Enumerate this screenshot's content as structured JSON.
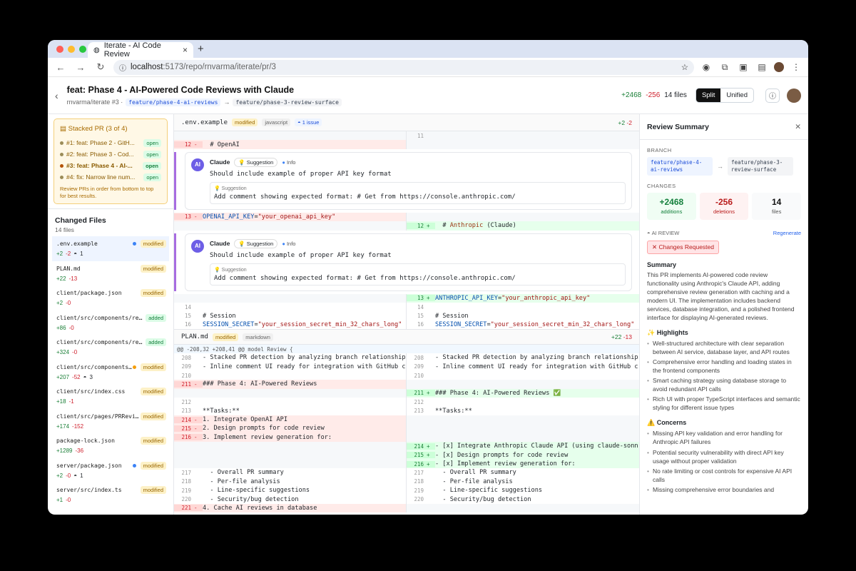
{
  "browser": {
    "tab_title": "Iterate - AI Code Review",
    "url_host": "localhost",
    "url_path": ":5173/repo/rnvarma/iterate/pr/3"
  },
  "header": {
    "title": "feat: Phase 4 - AI-Powered Code Reviews with Claude",
    "repo": "rnvarma/iterate #3 ·",
    "head_branch": "feature/phase-4-ai-reviews",
    "base_branch": "feature/phase-3-review-surface",
    "additions": "+2468",
    "deletions": "-256",
    "files": "14 files",
    "split": "Split",
    "unified": "Unified"
  },
  "stack": {
    "title": "Stacked PR (3 of 4)",
    "items": [
      {
        "label": "#1: feat: Phase 2 - GitH...",
        "status": "open"
      },
      {
        "label": "#2: feat: Phase 3 - Cod...",
        "status": "open"
      },
      {
        "label": "#3: feat: Phase 4 - AI-...",
        "status": "open"
      },
      {
        "label": "#4: fix: Narrow line num...",
        "status": "open"
      }
    ],
    "hint": "Review PRs in order from bottom to top for best results."
  },
  "changed": {
    "title": "Changed Files",
    "count": "14 files",
    "files": [
      {
        "name": ".env.example",
        "badge": "modified",
        "add": "+2",
        "del": "-2",
        "issues": "1",
        "dot": "#3b82f6"
      },
      {
        "name": "PLAN.md",
        "badge": "modified",
        "add": "+22",
        "del": "-13"
      },
      {
        "name": "client/package.json",
        "badge": "modified",
        "add": "+2",
        "del": "-0"
      },
      {
        "name": "client/src/components/re...",
        "badge": "added",
        "add": "+86",
        "del": "-0"
      },
      {
        "name": "client/src/components/re...",
        "badge": "added",
        "add": "+324",
        "del": "-0"
      },
      {
        "name": "client/src/components...",
        "badge": "modified",
        "add": "+207",
        "del": "-52",
        "issues": "3",
        "dot": "#f59e0b"
      },
      {
        "name": "client/src/index.css",
        "badge": "modified",
        "add": "+18",
        "del": "-1"
      },
      {
        "name": "client/src/pages/PRRevi...",
        "badge": "modified",
        "add": "+174",
        "del": "-152"
      },
      {
        "name": "package-lock.json",
        "badge": "modified",
        "add": "+1289",
        "del": "-36"
      },
      {
        "name": "server/package.json",
        "badge": "modified",
        "add": "+2",
        "del": "-0",
        "issues": "1",
        "dot": "#3b82f6"
      },
      {
        "name": "server/src/index.ts",
        "badge": "modified",
        "add": "+1",
        "del": "-0"
      }
    ]
  },
  "diff1": {
    "file": ".env.example",
    "status": "modified",
    "lang": "javascript",
    "issues": "1 issue",
    "add": "+2",
    "del": "-2",
    "comment": {
      "author": "Claude",
      "type": "Suggestion",
      "severity": "Info",
      "body": "Should include example of proper API key format",
      "sugg_label": "Suggestion",
      "sugg_body": "Add comment showing expected format: # Get from https://console.anthropic.com/"
    }
  },
  "diff2": {
    "file": "PLAN.md",
    "status": "modified",
    "lang": "markdown",
    "add": "+22",
    "del": "-13",
    "hunk": "@@ -208,32 +208,41 @@ model Review {"
  },
  "summary": {
    "title": "Review Summary",
    "branch_label": "BRANCH",
    "head": "feature/phase-4-ai-reviews",
    "base": "feature/phase-3-review-surface",
    "changes_label": "CHANGES",
    "add_v": "+2468",
    "add_k": "additions",
    "del_v": "-256",
    "del_k": "deletions",
    "files_v": "14",
    "files_k": "files",
    "ai_label": "AI REVIEW",
    "regen": "Regenerate",
    "verdict": "✕ Changes Requested",
    "sum_h": "Summary",
    "sum_t": "This PR implements AI-powered code review functionality using Anthropic's Claude API, adding comprehensive review generation with caching and a modern UI. The implementation includes backend services, database integration, and a polished frontend interface for displaying AI-generated reviews.",
    "hl_h": "✨ Highlights",
    "highlights": [
      "Well-structured architecture with clear separation between AI service, database layer, and API routes",
      "Comprehensive error handling and loading states in the frontend components",
      "Smart caching strategy using database storage to avoid redundant API calls",
      "Rich UI with proper TypeScript interfaces and semantic styling for different issue types"
    ],
    "cn_h": "⚠️ Concerns",
    "concerns": [
      "Missing API key validation and error handling for Anthropic API failures",
      "Potential security vulnerability with direct API key usage without proper validation",
      "No rate limiting or cost controls for expensive AI API calls",
      "Missing comprehensive error boundaries and"
    ]
  }
}
